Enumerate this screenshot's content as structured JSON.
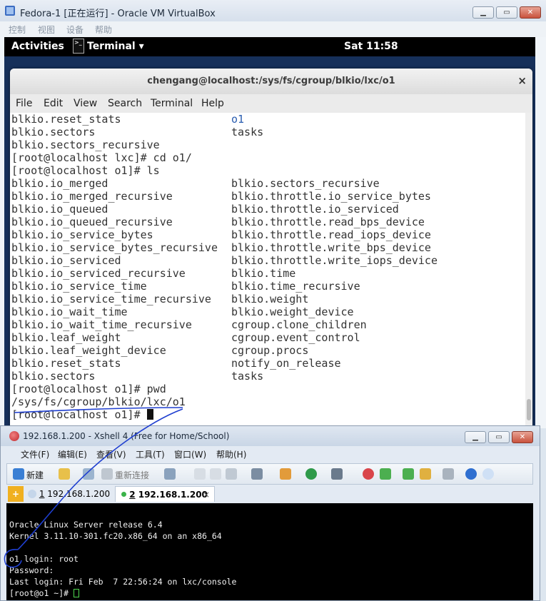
{
  "vbox": {
    "title": "Fedora-1 [正在运行] - Oracle VM VirtualBox",
    "menu": [
      "控制",
      "视图",
      "设备",
      "帮助"
    ],
    "buttons": {
      "minimize": "▁",
      "restore": "▭",
      "close": "✕"
    }
  },
  "gnome": {
    "activities": "Activities",
    "app": "Terminal ▾",
    "clock": "Sat 11:58"
  },
  "terminal": {
    "title": "chengang@localhost:/sys/fs/cgroup/blkio/lxc/o1",
    "close": "×",
    "menu": [
      "File",
      "Edit",
      "View",
      "Search",
      "Terminal",
      "Help"
    ],
    "lines": [
      {
        "a": "blkio.reset_stats",
        "b": "o1",
        "b_blue": true
      },
      {
        "a": "blkio.sectors",
        "b": "tasks"
      },
      {
        "a": "blkio.sectors_recursive",
        "b": ""
      },
      {
        "a": "[root@localhost lxc]# cd o1/",
        "b": ""
      },
      {
        "a": "[root@localhost o1]# ls",
        "b": ""
      },
      {
        "a": "blkio.io_merged",
        "b": "blkio.sectors_recursive"
      },
      {
        "a": "blkio.io_merged_recursive",
        "b": "blkio.throttle.io_service_bytes"
      },
      {
        "a": "blkio.io_queued",
        "b": "blkio.throttle.io_serviced"
      },
      {
        "a": "blkio.io_queued_recursive",
        "b": "blkio.throttle.read_bps_device"
      },
      {
        "a": "blkio.io_service_bytes",
        "b": "blkio.throttle.read_iops_device"
      },
      {
        "a": "blkio.io_service_bytes_recursive",
        "b": "blkio.throttle.write_bps_device"
      },
      {
        "a": "blkio.io_serviced",
        "b": "blkio.throttle.write_iops_device"
      },
      {
        "a": "blkio.io_serviced_recursive",
        "b": "blkio.time"
      },
      {
        "a": "blkio.io_service_time",
        "b": "blkio.time_recursive"
      },
      {
        "a": "blkio.io_service_time_recursive",
        "b": "blkio.weight"
      },
      {
        "a": "blkio.io_wait_time",
        "b": "blkio.weight_device"
      },
      {
        "a": "blkio.io_wait_time_recursive",
        "b": "cgroup.clone_children"
      },
      {
        "a": "blkio.leaf_weight",
        "b": "cgroup.event_control"
      },
      {
        "a": "blkio.leaf_weight_device",
        "b": "cgroup.procs"
      },
      {
        "a": "blkio.reset_stats",
        "b": "notify_on_release"
      },
      {
        "a": "blkio.sectors",
        "b": "tasks"
      },
      {
        "a": "[root@localhost o1]# pwd",
        "b": ""
      },
      {
        "a": "/sys/fs/cgroup/blkio/lxc/o1",
        "b": ""
      },
      {
        "a": "[root@localhost o1]# ",
        "b": "",
        "cursor": true
      }
    ]
  },
  "xshell": {
    "title": "192.168.1.200 - Xshell 4 (Free for Home/School)",
    "menu": [
      "文件(F)",
      "编辑(E)",
      "查看(V)",
      "工具(T)",
      "窗口(W)",
      "帮助(H)"
    ],
    "toolbar": {
      "new": "新建",
      "reconnect": "重新连接"
    },
    "tabs": [
      {
        "num": "1",
        "label": "192.168.1.200"
      },
      {
        "num": "2",
        "label": "192.168.1.200",
        "active": true
      }
    ],
    "tab_close": "×",
    "lines": [
      "",
      "Oracle Linux Server release 6.4",
      "Kernel 3.11.10-301.fc20.x86_64 on an x86_64",
      "",
      "o1 login: root",
      "Password:",
      "Last login: Fri Feb  7 22:56:24 on lxc/console",
      "[root@o1 ~]# "
    ]
  },
  "colors": {
    "annotation": "#1f3fd0",
    "ls_dir": "#2a5db0",
    "xshell_cursor": "#4fd64f"
  }
}
